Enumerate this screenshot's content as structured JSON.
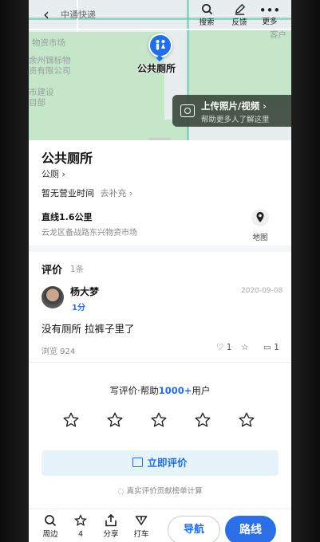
{
  "topbar": {
    "title": "中通快递",
    "search_label": "搜索",
    "feedback_label": "反馈",
    "more_label": "更多"
  },
  "map": {
    "labels": [
      "物资市场",
      "余州锦标物",
      "资有限公司",
      "市建设",
      "目部",
      "客户"
    ],
    "pin_label": "公共厕所",
    "upload_title": "上传照片/视频 ›",
    "upload_sub": "帮助更多人了解这里"
  },
  "place": {
    "name": "公共厕所",
    "category": "公厕 ›",
    "hours": "暂无营业时间",
    "hours_add": "去补充 ›",
    "distance": "直线1.6公里",
    "address": "云龙区备战路东兴物资市场",
    "map_label": "地图"
  },
  "reviews": {
    "heading": "评价",
    "count": "1条",
    "item": {
      "user": "杨大梦",
      "score": "1分",
      "date": "2020-09-08",
      "text": "没有厕所  拉裤子里了",
      "views": "浏览 924",
      "likes": "1",
      "comments": "1"
    }
  },
  "write": {
    "prefix": "写评价·帮助",
    "highlight": "1000+",
    "suffix": "用户",
    "button": "立即评价",
    "note": "真实评价贡献榜单计算"
  },
  "bottom": {
    "nearby": "周边",
    "fav": "4",
    "share": "分享",
    "taxi": "打车",
    "nav": "导航",
    "route": "路线"
  },
  "colors": {
    "accent": "#1e6ef0",
    "map_green": "#c5e6c9",
    "road": "#6ec9b2"
  }
}
